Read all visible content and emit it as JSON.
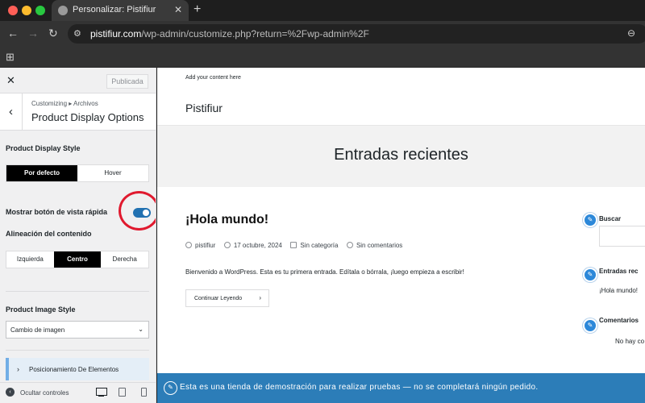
{
  "browser": {
    "tab_title": "Personalizar: Pistifiur",
    "url_host": "pistifiur.com",
    "url_path": "/wp-admin/customize.php?return=%2Fwp-admin%2F",
    "icons": [
      "globe-icon",
      "close-icon",
      "plus-icon",
      "back-arrow-icon",
      "forward-arrow-icon",
      "reload-icon",
      "site-settings-icon",
      "apps-grid-icon"
    ]
  },
  "customizer": {
    "publish_label": "Publicada",
    "breadcrumb": "Customizing ▸ Archivos",
    "panel_title": "Product Display Options",
    "display_style": {
      "label": "Product Display Style",
      "options": [
        "Por defecto",
        "Hover"
      ],
      "selected": "Por defecto"
    },
    "quick_view": {
      "label": "Mostrar botón de vista rápida",
      "enabled": true
    },
    "alignment": {
      "label": "Alineación del contenido",
      "options": [
        "Izquierda",
        "Centro",
        "Derecha"
      ],
      "selected": "Centro"
    },
    "image_style": {
      "label": "Product Image Style",
      "value": "Cambio de imagen"
    },
    "section_link": "Posicionamiento De Elementos",
    "hide_controls": "Ocultar controles",
    "accent_color": "#2271b1",
    "highlight_color": "#e0192e"
  },
  "preview": {
    "top_note": "Add your content here",
    "site_title": "Pistifiur",
    "hero_title": "Entradas recientes",
    "post": {
      "title": "¡Hola mundo!",
      "author": "pistifiur",
      "date": "17 octubre, 2024",
      "category": "Sin categoría",
      "comments": "Sin comentarios",
      "excerpt": "Bienvenido a WordPress. Esta es tu primera entrada. Edítala o bórrala, ¡luego empieza a escribir!",
      "read_more": "Continuar Leyendo"
    },
    "widgets": {
      "search_title": "Buscar",
      "recent_title": "Entradas rec",
      "recent_item": "¡Hola mundo!",
      "comments_title": "Comentarios",
      "comments_item": "No hay co"
    },
    "banner": "Esta es una tienda de demostración para realizar pruebas — no se completará ningún pedido.",
    "banner_color": "#2c7db8"
  }
}
